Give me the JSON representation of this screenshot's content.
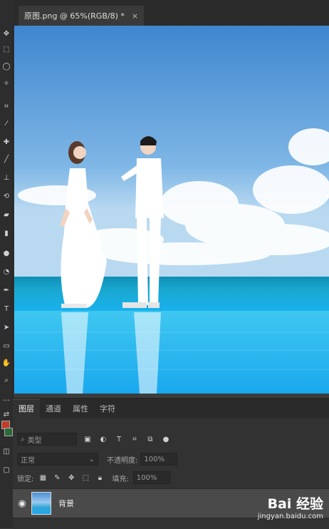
{
  "document": {
    "tab_title": "原图.png @ 65%(RGB/8) *",
    "close_symbol": "×"
  },
  "layers_panel": {
    "tabs": [
      {
        "label": "图层",
        "active": true
      },
      {
        "label": "通道",
        "active": false
      },
      {
        "label": "属性",
        "active": false
      },
      {
        "label": "字符",
        "active": false
      }
    ],
    "filter_placeholder": "类型",
    "blend_mode": "正常",
    "opacity_label": "不透明度:",
    "opacity_value": "100%",
    "lock_label": "锁定:",
    "fill_label": "填充:",
    "fill_value": "100%",
    "layers": [
      {
        "name": "背景",
        "visible": true,
        "locked": true
      }
    ]
  },
  "watermark": {
    "brand": "Bai 经验",
    "url": "jingyan.baidu.com"
  },
  "colors": {
    "foreground": "#c43a2a",
    "background": "#2d6a3a"
  }
}
